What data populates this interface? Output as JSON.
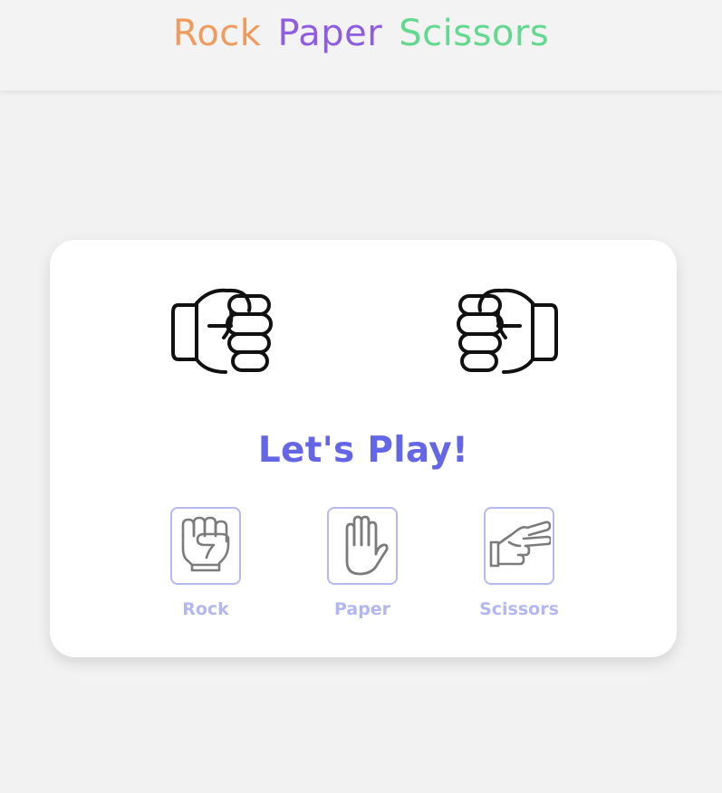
{
  "header": {
    "title_words": [
      "Rock",
      "Paper",
      "Scissors"
    ],
    "title_colors": [
      "#ef9a5e",
      "#8f5de0",
      "#63d88f"
    ]
  },
  "game": {
    "status": "Let's Play!",
    "status_color": "#6566e5",
    "player_hand_icon": "fist-icon",
    "computer_hand_icon": "fist-icon"
  },
  "choices": [
    {
      "label": "Rock",
      "icon": "rock-fist-icon"
    },
    {
      "label": "Paper",
      "icon": "paper-hand-icon"
    },
    {
      "label": "Scissors",
      "icon": "scissors-hand-icon"
    }
  ],
  "colors": {
    "choice_border": "#b7b8f0",
    "choice_label": "#b4b7ef",
    "choice_icon": "#7b7b7b"
  }
}
